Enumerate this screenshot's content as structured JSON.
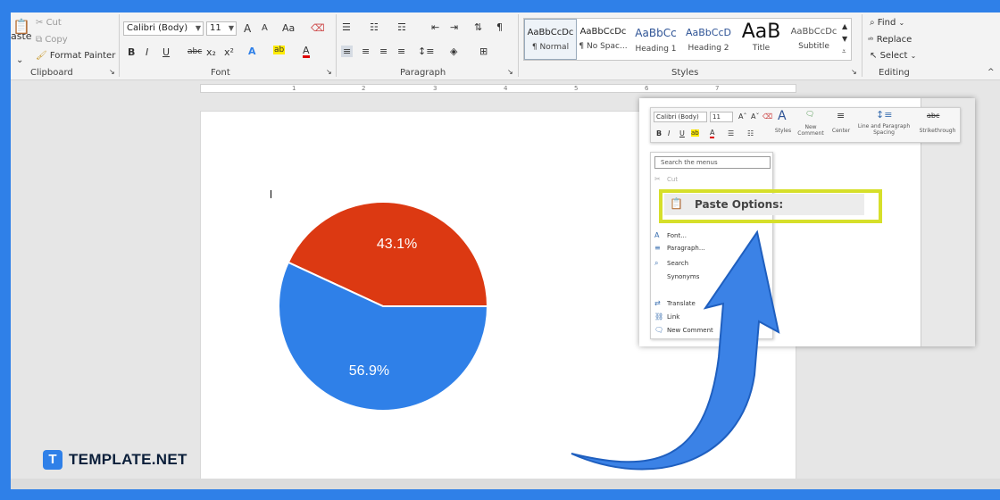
{
  "clipboard": {
    "paste": "aste",
    "paste_dd": "⌄",
    "cut": "Cut",
    "copy": "Copy",
    "format_painter": "Format Painter",
    "group": "Clipboard"
  },
  "font": {
    "name": "Calibri (Body)",
    "size": "11",
    "group": "Font",
    "case_label": "Aa",
    "bold": "B",
    "italic": "I",
    "underline": "U",
    "strike": "abc",
    "sub": "x₂",
    "sup": "x²",
    "grow": "A",
    "shrink": "A",
    "effects": "A",
    "highlight": "ab",
    "color": "A"
  },
  "paragraph": {
    "group": "Paragraph",
    "pilcrow": "¶"
  },
  "styles": {
    "group": "Styles",
    "items": [
      {
        "sample": "AaBbCcDc",
        "name": "¶ Normal"
      },
      {
        "sample": "AaBbCcDc",
        "name": "¶ No Spac..."
      },
      {
        "sample": "AaBbCc",
        "name": "Heading 1"
      },
      {
        "sample": "AaBbCcD",
        "name": "Heading 2"
      },
      {
        "sample": "AaB",
        "name": "Title"
      },
      {
        "sample": "AaBbCcDc",
        "name": "Subtitle"
      }
    ]
  },
  "editing": {
    "group": "Editing",
    "find": "Find",
    "replace": "Replace",
    "select": "Select"
  },
  "ruler": {
    "ticks": [
      "1",
      "2",
      "3",
      "4",
      "5",
      "6",
      "7"
    ]
  },
  "chart_data": {
    "type": "pie",
    "slices": [
      {
        "label": "43.1%",
        "value": 43.1,
        "color": "#dc3912"
      },
      {
        "label": "56.9%",
        "value": 56.9,
        "color": "#2f80e8"
      }
    ]
  },
  "minibar": {
    "font": "Calibri (Body)",
    "size": "11",
    "styles": "Styles",
    "new_comment": "New Comment",
    "center": "Center",
    "line_spacing": "Line and Paragraph Spacing",
    "strikethrough": "Strikethrough",
    "bold": "B",
    "italic": "I",
    "underline": "U"
  },
  "context_menu": {
    "search_placeholder": "Search the menus",
    "items": [
      "Cut",
      "Font...",
      "Paragraph...",
      "Search",
      "Synonyms",
      "Translate",
      "Link",
      "New Comment"
    ],
    "paste_options": "Paste Options:"
  },
  "logo": {
    "mark": "T",
    "text": "TEMPLATE.NET"
  },
  "colors": {
    "accent": "#2f80e8",
    "pie_red": "#dc3912",
    "highlight_box": "#d6df2a"
  }
}
